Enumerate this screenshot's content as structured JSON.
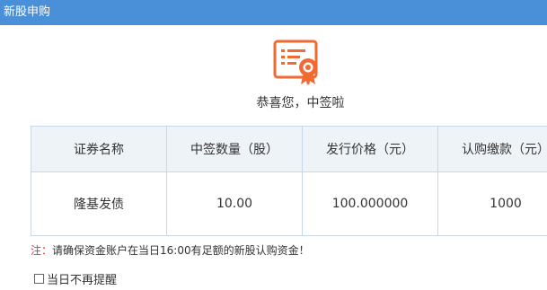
{
  "window": {
    "title": "新股申购"
  },
  "result": {
    "icon": "certificate-award-icon",
    "message": "恭喜您，中签啦"
  },
  "table": {
    "headers": [
      "证券名称",
      "中签数量（股）",
      "发行价格（元）",
      "认购缴款（元）"
    ],
    "rows": [
      [
        "隆基发债",
        "10.00",
        "100.000000",
        "1000"
      ]
    ]
  },
  "notice": {
    "prefix": "注：",
    "text": "请确保资金账户在当日16:00有足额的新股认购资金！"
  },
  "remember": {
    "label": "当日不再提醒",
    "checked": false
  },
  "colors": {
    "titlebar": "#4a90d9",
    "icon": "#f26a31",
    "warning": "#e5312a",
    "table_header": "#eef3f8"
  }
}
